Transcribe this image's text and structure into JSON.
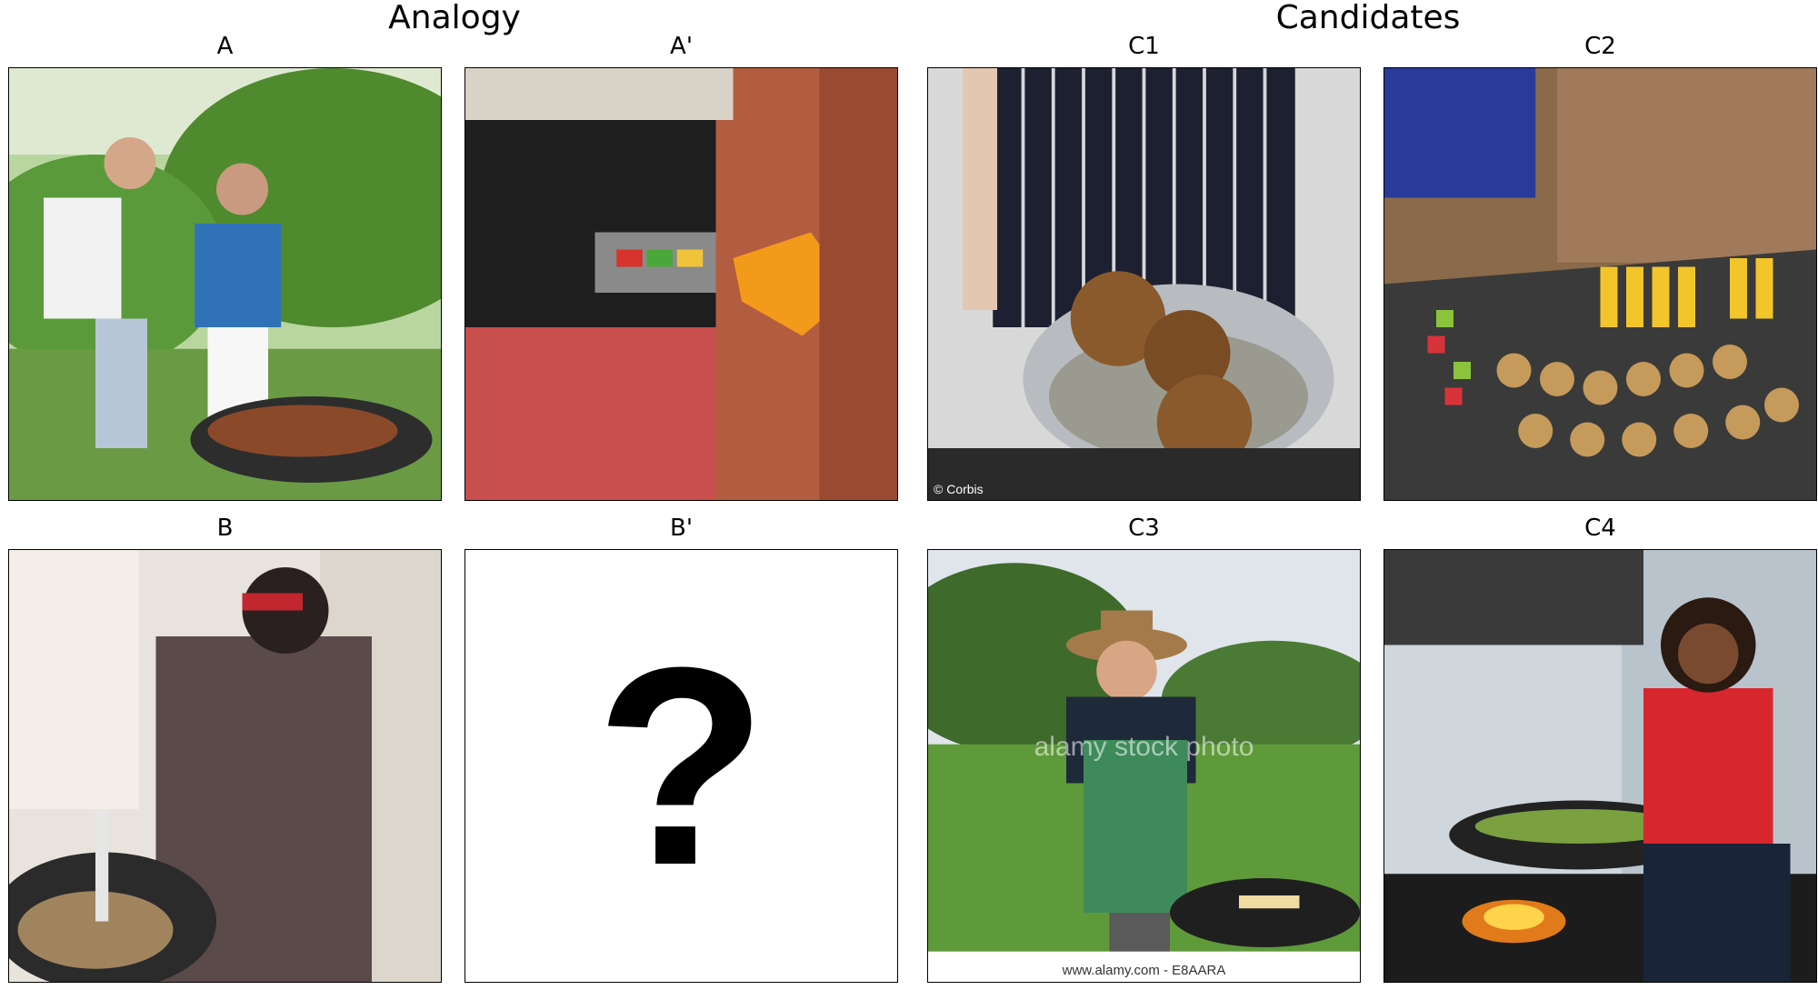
{
  "headings": {
    "analogy": "Analogy",
    "candidates": "Candidates"
  },
  "panels": {
    "A": {
      "label": "A"
    },
    "Ap": {
      "label": "A'"
    },
    "B": {
      "label": "B"
    },
    "Bp": {
      "label": "B'",
      "placeholder": "?"
    },
    "C1": {
      "label": "C1",
      "credit": "© Corbis"
    },
    "C2": {
      "label": "C2"
    },
    "C3": {
      "label": "C3",
      "watermark": "alamy stock photo",
      "footer": "www.alamy.com - E8AARA"
    },
    "C4": {
      "label": "C4"
    }
  }
}
